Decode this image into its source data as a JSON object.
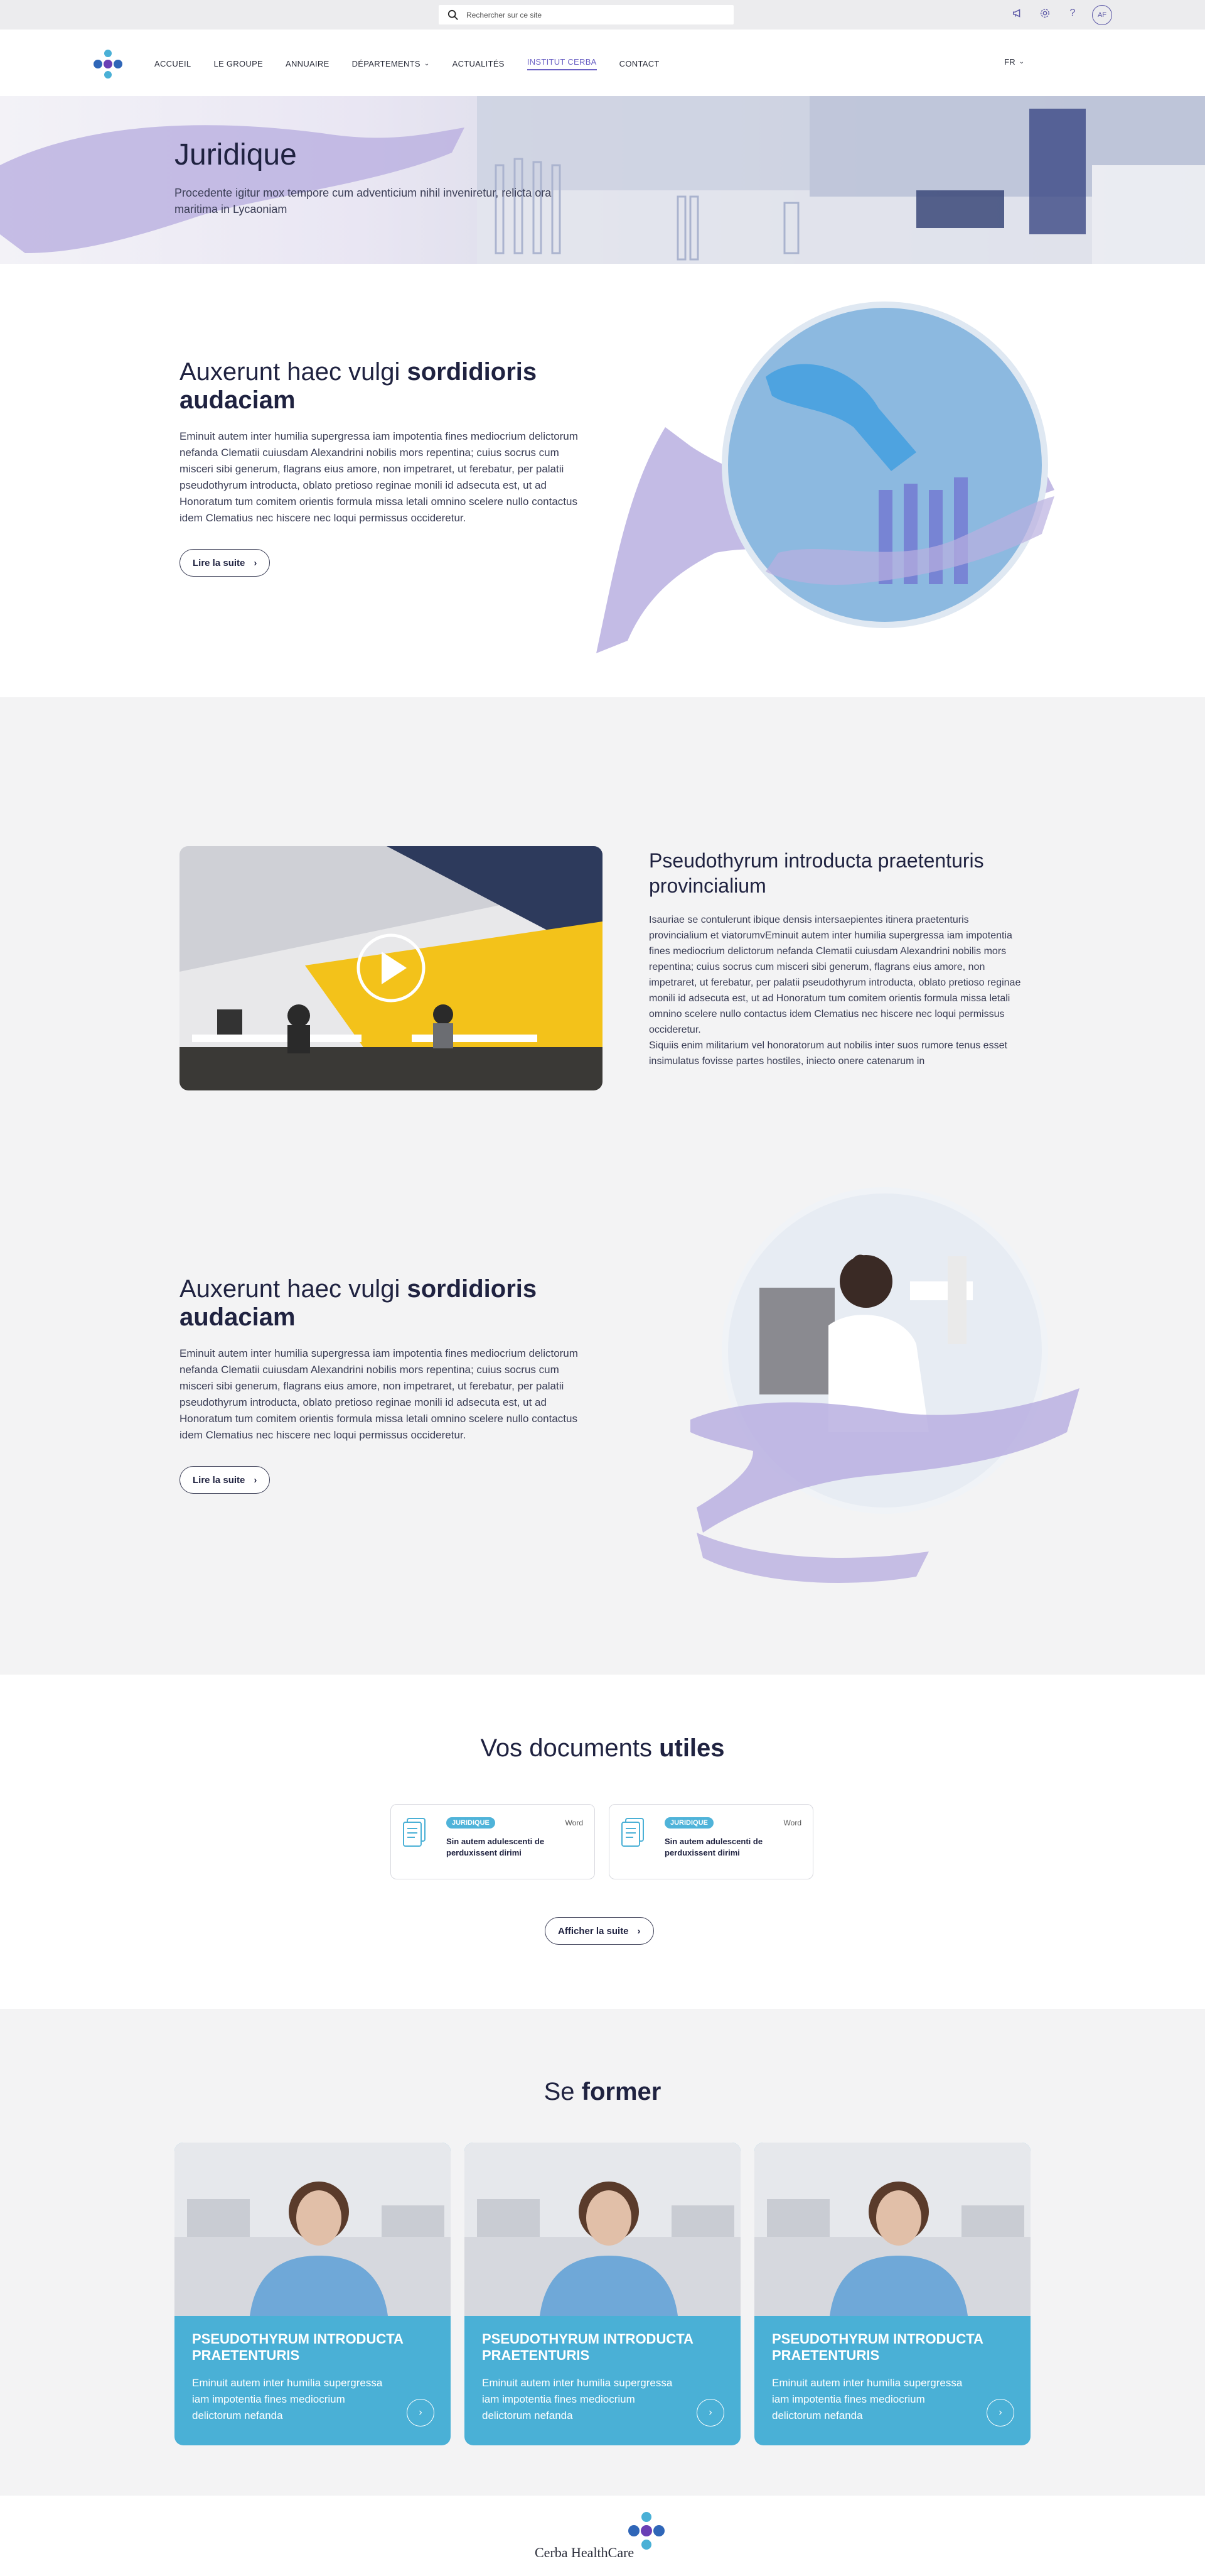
{
  "topbar": {
    "search_placeholder": "Rechercher sur ce site",
    "avatar_initials": "AF"
  },
  "nav": {
    "items": [
      {
        "label": "ACCUEIL"
      },
      {
        "label": "LE GROUPE"
      },
      {
        "label": "ANNUAIRE"
      },
      {
        "label": "DÉPARTEMENTS"
      },
      {
        "label": "ACTUALITÉS"
      },
      {
        "label": "INSTITUT CERBA"
      },
      {
        "label": "CONTACT"
      }
    ],
    "active": "INSTITUT CERBA",
    "lang": "FR"
  },
  "hero": {
    "title": "Juridique",
    "subtitle": "Procedente igitur mox tempore cum adventicium nihil inveniretur, relicta ora maritima in Lycaoniam"
  },
  "block1": {
    "title_normal": "Auxerunt haec vulgi ",
    "title_bold": "sordidioris audaciam",
    "text": "Eminuit autem inter humilia supergressa iam impotentia fines mediocrium delictorum nefanda Clematii cuiusdam Alexandrini nobilis mors repentina; cuius socrus cum misceri sibi generum, flagrans eius amore, non impetraret, ut ferebatur, per palatii pseudothyrum introducta, oblato pretioso reginae monili id adsecuta est, ut ad Honoratum tum comitem orientis formula missa letali omnino scelere nullo contactus idem Clematius nec hiscere nec loqui permissus occideretur.",
    "button": "Lire la suite"
  },
  "block2": {
    "title": "Pseudothyrum introducta praetenturis provincialium",
    "text": "Isauriae se contulerunt ibique densis intersaepientes itinera praetenturis provincialium et viatorumvEminuit autem inter humilia supergressa iam impotentia fines mediocrium delictorum nefanda Clematii cuiusdam Alexandrini nobilis mors repentina; cuius socrus cum misceri sibi generum, flagrans eius amore, non impetraret, ut ferebatur, per palatii pseudothyrum introducta, oblato pretioso reginae monili id adsecuta est, ut ad Honoratum tum comitem orientis formula missa letali omnino scelere nullo contactus idem Clematius nec hiscere nec loqui permissus occideretur.",
    "text2": "Siquiis enim militarium vel honoratorum aut nobilis inter suos rumore tenus esset insimulatus fovisse partes hostiles, iniecto onere catenarum in"
  },
  "block3": {
    "title_normal": "Auxerunt haec vulgi ",
    "title_bold": "sordidioris audaciam",
    "text": "Eminuit autem inter humilia supergressa iam impotentia fines mediocrium delictorum nefanda Clematii cuiusdam Alexandrini nobilis mors repentina; cuius socrus cum misceri sibi generum, flagrans eius amore, non impetraret, ut ferebatur, per palatii pseudothyrum introducta, oblato pretioso reginae monili id adsecuta est, ut ad Honoratum tum comitem orientis formula missa letali omnino scelere nullo contactus idem Clematius nec hiscere nec loqui permissus occideretur.",
    "button": "Lire la suite"
  },
  "documents": {
    "title_normal": "Vos documents ",
    "title_bold": "utiles",
    "cards": [
      {
        "tag": "JURIDIQUE",
        "format": "Word",
        "title": "Sin autem adulescenti de perduxissent dirimi"
      },
      {
        "tag": "JURIDIQUE",
        "format": "Word",
        "title": "Sin autem adulescenti de perduxissent dirimi"
      }
    ],
    "button": "Afficher la suite"
  },
  "training": {
    "title_normal": "Se ",
    "title_bold": "former",
    "cards": [
      {
        "title": "PSEUDOTHYRUM INTRODUCTA PRAETENTURIS",
        "text": "Eminuit autem inter humilia supergressa iam impotentia fines mediocrium delictorum nefanda"
      },
      {
        "title": "PSEUDOTHYRUM INTRODUCTA PRAETENTURIS",
        "text": "Eminuit autem inter humilia supergressa iam impotentia fines mediocrium delictorum nefanda"
      },
      {
        "title": "PSEUDOTHYRUM INTRODUCTA PRAETENTURIS",
        "text": "Eminuit autem inter humilia supergressa iam impotentia fines mediocrium delictorum nefanda"
      }
    ]
  },
  "footer": {
    "brand": "Cerba HealthCare"
  },
  "colors": {
    "accent": "#6a60c4",
    "lilac": "#b9afe0",
    "teal": "#4ab0d6",
    "dark": "#1f2240"
  }
}
